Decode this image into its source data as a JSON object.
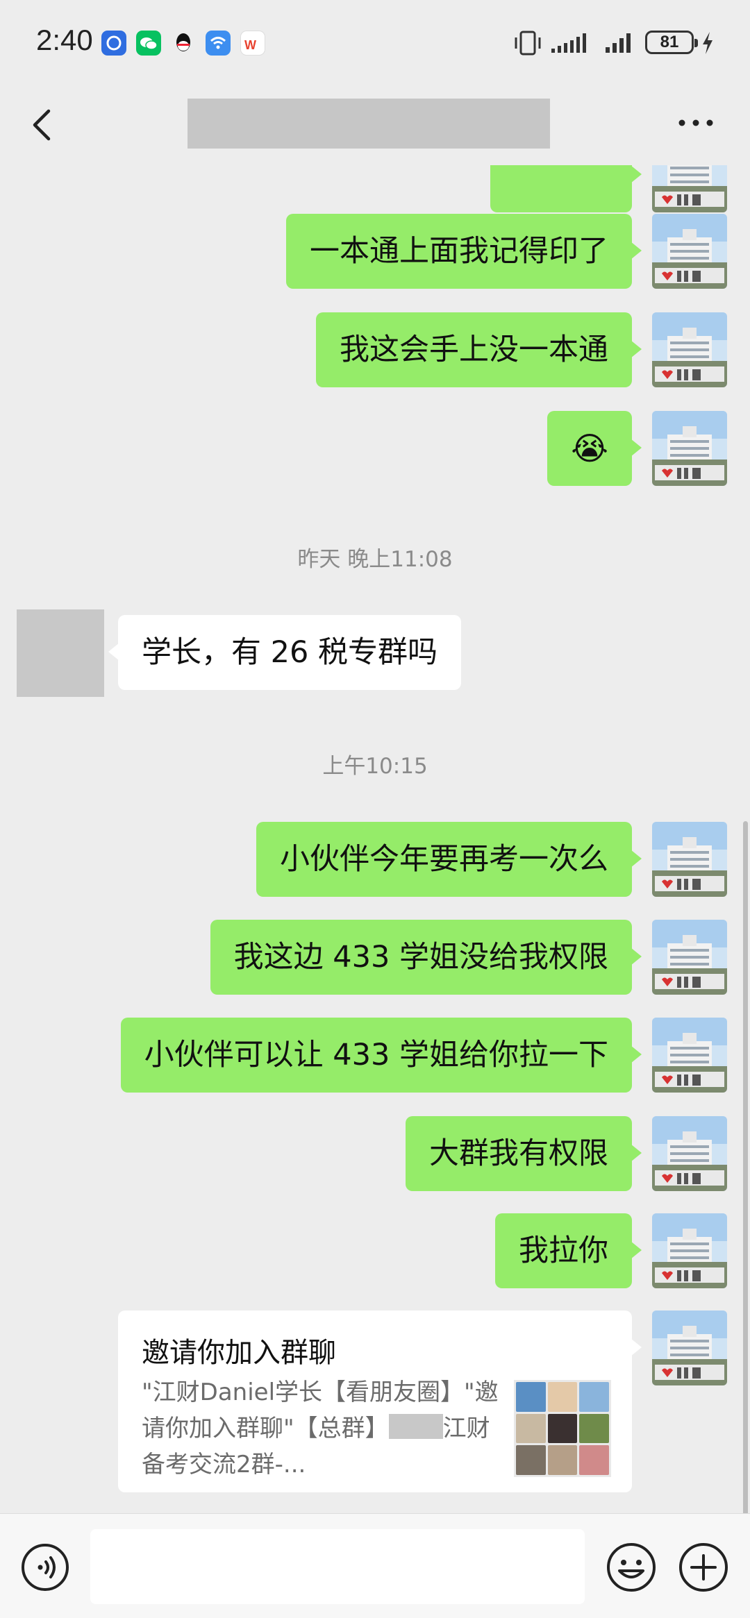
{
  "status_bar": {
    "time": "2:40",
    "battery": "81",
    "app_icons": [
      "baidu-netdisk-icon",
      "wechat-icon",
      "qq-icon",
      "wifi-app-icon",
      "wps-icon"
    ]
  },
  "nav": {
    "title_redacted": true,
    "back_icon": "chevron-left-icon",
    "more_icon": "more-dots-icon"
  },
  "messages": [
    {
      "side": "out",
      "text": "一本通上面我记得印了"
    },
    {
      "side": "out",
      "text": "我这会手上没一本通"
    },
    {
      "side": "out",
      "text": "😭"
    },
    {
      "type": "time",
      "text": "昨天 晚上11:08"
    },
    {
      "side": "in",
      "text": "学长，有 26 税专群吗"
    },
    {
      "type": "time",
      "text": "上午10:15"
    },
    {
      "side": "out",
      "text": "小伙伴今年要再考一次么"
    },
    {
      "side": "out",
      "text": "我这边 433 学姐没给我权限"
    },
    {
      "side": "out",
      "text": "小伙伴可以让 433 学姐给你拉一下"
    },
    {
      "side": "out",
      "text": "大群我有权限"
    },
    {
      "side": "out",
      "text": "我拉你"
    }
  ],
  "invite_card": {
    "title": "邀请你加入群聊",
    "desc_part1": "\"江财Daniel学长【看朋友圈】\"邀请你加入群聊\"【总群】",
    "desc_part2": "江财备考交流2群-..."
  },
  "input_bar": {
    "voice_icon": "voice-icon",
    "emoji_icon": "emoji-icon",
    "plus_icon": "plus-icon"
  },
  "colors": {
    "outgoing_bubble": "#95ec69",
    "incoming_bubble": "#ffffff",
    "background": "#ededed"
  }
}
